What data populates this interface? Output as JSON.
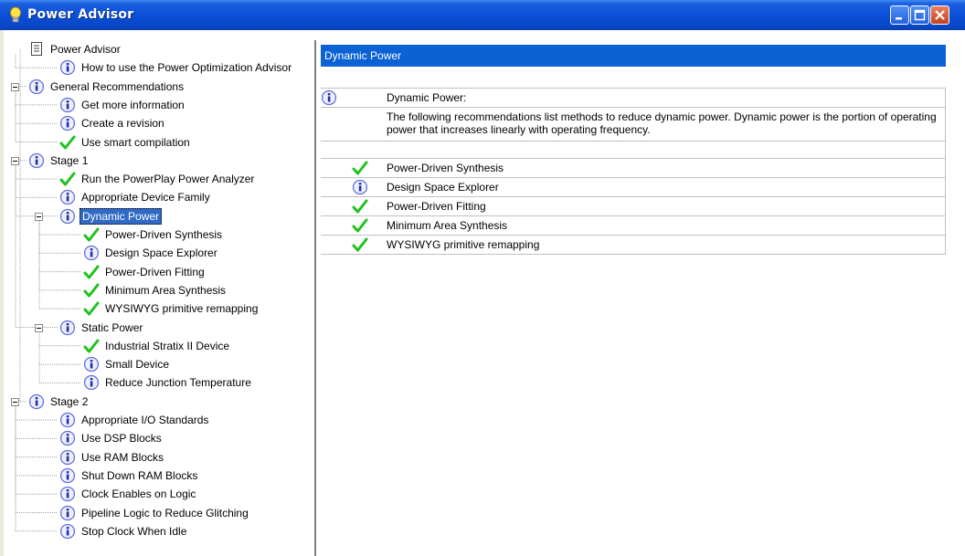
{
  "window": {
    "title": "Power Advisor",
    "accent_color": "#0a4fd8",
    "selection_color": "#316ac5",
    "header_color": "#0a62d4"
  },
  "tree": {
    "items": [
      {
        "label": "Power Advisor",
        "icon": "document-icon",
        "level": 0
      },
      {
        "label": "How to use the Power Optimization Advisor",
        "icon": "info-icon",
        "level": 1
      },
      {
        "label": "General Recommendations",
        "icon": "info-icon",
        "level": 0,
        "expanded": true
      },
      {
        "label": "Get more information",
        "icon": "info-icon",
        "level": 1
      },
      {
        "label": "Create a revision",
        "icon": "info-icon",
        "level": 1
      },
      {
        "label": "Use smart compilation",
        "icon": "check-icon",
        "level": 1
      },
      {
        "label": "Stage 1",
        "icon": "info-icon",
        "level": 0,
        "expanded": true
      },
      {
        "label": "Run the PowerPlay Power Analyzer",
        "icon": "check-icon",
        "level": 1
      },
      {
        "label": "Appropriate Device Family",
        "icon": "info-icon",
        "level": 1
      },
      {
        "label": "Dynamic Power",
        "icon": "info-icon",
        "level": 1,
        "expanded": true,
        "selected": true
      },
      {
        "label": "Power-Driven Synthesis",
        "icon": "check-icon",
        "level": 2
      },
      {
        "label": "Design Space Explorer",
        "icon": "info-icon",
        "level": 2
      },
      {
        "label": "Power-Driven Fitting",
        "icon": "check-icon",
        "level": 2
      },
      {
        "label": "Minimum Area Synthesis",
        "icon": "check-icon",
        "level": 2
      },
      {
        "label": "WYSIWYG primitive remapping",
        "icon": "check-icon",
        "level": 2
      },
      {
        "label": "Static Power",
        "icon": "info-icon",
        "level": 1,
        "expanded": true
      },
      {
        "label": "Industrial Stratix II Device",
        "icon": "check-icon",
        "level": 2
      },
      {
        "label": "Small Device",
        "icon": "info-icon",
        "level": 2
      },
      {
        "label": "Reduce Junction Temperature",
        "icon": "info-icon",
        "level": 2
      },
      {
        "label": "Stage 2",
        "icon": "info-icon",
        "level": 0,
        "expanded": true
      },
      {
        "label": "Appropriate I/O Standards",
        "icon": "info-icon",
        "level": 1
      },
      {
        "label": "Use DSP Blocks",
        "icon": "info-icon",
        "level": 1
      },
      {
        "label": "Use RAM Blocks",
        "icon": "info-icon",
        "level": 1
      },
      {
        "label": "Shut Down RAM Blocks",
        "icon": "info-icon",
        "level": 1
      },
      {
        "label": "Clock Enables on Logic",
        "icon": "info-icon",
        "level": 1
      },
      {
        "label": "Pipeline Logic to Reduce Glitching",
        "icon": "info-icon",
        "level": 1
      },
      {
        "label": "Stop Clock When Idle",
        "icon": "info-icon",
        "level": 1
      }
    ]
  },
  "details": {
    "header": "Dynamic Power",
    "heading": "Dynamic Power:",
    "description": "The following recommendations list methods to reduce dynamic power. Dynamic power is the portion of operating power that increases linearly with operating frequency.",
    "rows": [
      {
        "label": "Power-Driven Synthesis",
        "icon": "check-icon"
      },
      {
        "label": "Design Space Explorer",
        "icon": "info-icon"
      },
      {
        "label": "Power-Driven Fitting",
        "icon": "check-icon"
      },
      {
        "label": "Minimum Area Synthesis",
        "icon": "check-icon"
      },
      {
        "label": "WYSIWYG primitive remapping",
        "icon": "check-icon"
      }
    ]
  }
}
